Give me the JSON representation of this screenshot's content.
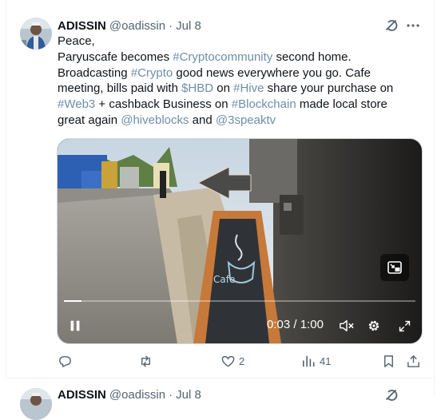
{
  "tweet": {
    "display_name": "ADISSIN",
    "handle": "@oadissin",
    "separator": "·",
    "date": "Jul 8",
    "lines": [
      [
        {
          "t": "Peace,",
          "link": false
        }
      ],
      [
        {
          "t": "Paryuscafe becomes ",
          "link": false
        },
        {
          "t": "#Cryptocommunity",
          "link": true
        },
        {
          "t": " second home.",
          "link": false
        }
      ],
      [
        {
          "t": "Broadcasting ",
          "link": false
        },
        {
          "t": "#Crypto",
          "link": true
        },
        {
          "t": " good news everywhere you go. Cafe",
          "link": false
        }
      ],
      [
        {
          "t": "meeting,  bills paid with ",
          "link": false
        },
        {
          "t": "$HBD",
          "link": true
        },
        {
          "t": " on ",
          "link": false
        },
        {
          "t": "#Hive",
          "link": true
        },
        {
          "t": " share your purchase on",
          "link": false
        }
      ],
      [
        {
          "t": "#Web3",
          "link": true
        },
        {
          "t": " + cashback Business on ",
          "link": false
        },
        {
          "t": "#Blockchain",
          "link": true
        },
        {
          "t": " made local store",
          "link": false
        }
      ],
      [
        {
          "t": "great again  ",
          "link": false
        },
        {
          "t": "@hiveblocks",
          "link": true
        },
        {
          "t": " and ",
          "link": false
        },
        {
          "t": "@3speaktv",
          "link": true
        }
      ]
    ]
  },
  "video": {
    "time_current": "0:03",
    "time_separator": "/",
    "time_total": "1:00",
    "progress_fraction": 0.05,
    "state": "paused",
    "muted": true
  },
  "actions": {
    "replies": "",
    "reposts": "",
    "likes": "2",
    "views": "41"
  },
  "next_tweet": {
    "display_name": "ADISSIN",
    "handle": "@oadissin",
    "separator": "·",
    "date": "Jul 8"
  },
  "colors": {
    "link": "#6b8fab",
    "text": "#0f1419",
    "muted": "#536471",
    "border": "#cfd9de"
  },
  "icons": [
    "grok-icon",
    "more-icon",
    "pip-icon",
    "pause-icon",
    "mute-icon",
    "settings-icon",
    "fullscreen-icon",
    "reply-icon",
    "repost-icon",
    "like-icon",
    "views-icon",
    "bookmark-icon",
    "share-icon"
  ]
}
